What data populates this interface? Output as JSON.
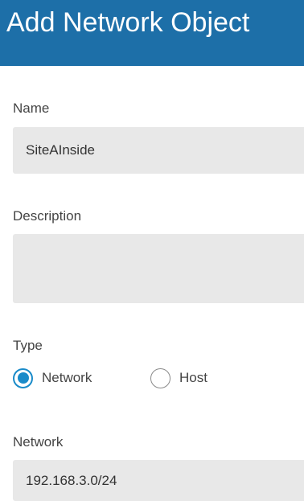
{
  "dialog": {
    "title": "Add Network Object"
  },
  "name": {
    "label": "Name",
    "value": "SiteAInside"
  },
  "description": {
    "label": "Description",
    "value": ""
  },
  "type": {
    "label": "Type",
    "options": [
      {
        "label": "Network",
        "selected": true
      },
      {
        "label": "Host",
        "selected": false
      }
    ]
  },
  "network": {
    "label": "Network",
    "value": "192.168.3.0/24"
  },
  "colors": {
    "header_background": "#1d6fa8",
    "radio_accent": "#1a8bc9",
    "field_background": "#e8e8e8"
  }
}
